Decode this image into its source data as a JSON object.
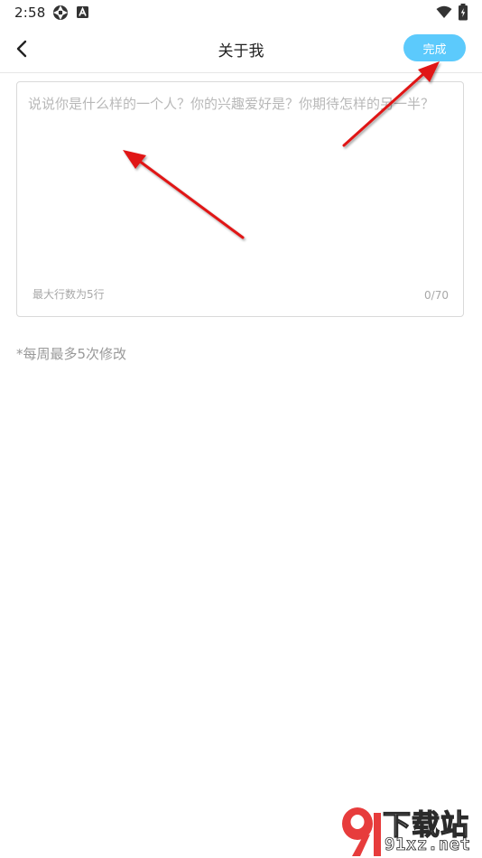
{
  "status_bar": {
    "time": "2:58",
    "left_icons": [
      "aperture-icon",
      "a-badge-icon"
    ],
    "right_icons": [
      "wifi-icon",
      "battery-icon"
    ]
  },
  "header": {
    "back_icon": "chevron-left-icon",
    "title": "关于我",
    "done_label": "完成"
  },
  "bio_editor": {
    "value": "",
    "placeholder": "说说你是什么样的一个人？你的兴趣爱好是？你期待怎样的另一半？",
    "line_hint": "最大行数为5行",
    "char_count": "0/70"
  },
  "weekly_note": "*每周最多5次修改",
  "watermark": {
    "logo_icon": "91-logo-icon",
    "line1": "下载站",
    "line2": "91xz.net"
  },
  "colors": {
    "accent": "#5ccafc",
    "annotation_arrow": "#e01515",
    "watermark_logo": "#e73c3c"
  }
}
